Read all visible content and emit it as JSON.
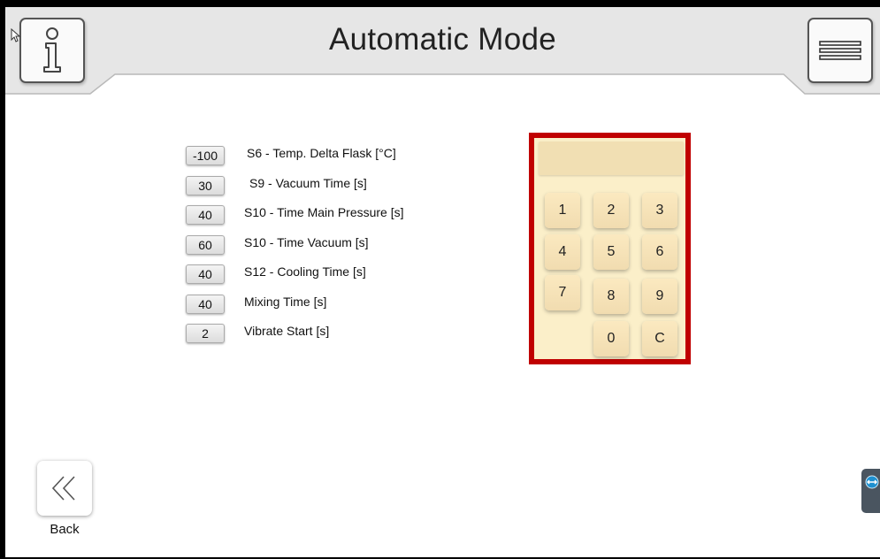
{
  "header": {
    "title": "Automatic Mode"
  },
  "icons": {
    "info": "info-icon",
    "menu": "hamburger-menu-icon",
    "back": "double-chevron-left-icon",
    "side_tab": "remote-support-icon",
    "cursor": "mouse-pointer-icon"
  },
  "parameters": [
    {
      "value": "-100",
      "label": "S6 - Temp. Delta Flask [°C]"
    },
    {
      "value": "30",
      "label": "S9 - Vacuum Time [s]"
    },
    {
      "value": "40",
      "label": "S10 - Time Main Pressure [s]"
    },
    {
      "value": "60",
      "label": "S10 - Time Vacuum [s]"
    },
    {
      "value": "40",
      "label": "S12 - Cooling Time [s]"
    },
    {
      "value": "40",
      "label": "Mixing Time [s]"
    },
    {
      "value": "2",
      "label": "Vibrate Start [s]"
    }
  ],
  "keypad": {
    "display": "",
    "keys": [
      "1",
      "2",
      "3",
      "4",
      "5",
      "6",
      "7",
      "8",
      "9",
      "0",
      "C"
    ]
  },
  "footer": {
    "back_label": "Back"
  },
  "colors": {
    "keypad_border": "#c00000",
    "keypad_background": "#fbefc9",
    "key_background": "#f3dfb3",
    "header_background": "#e6e6e6"
  }
}
